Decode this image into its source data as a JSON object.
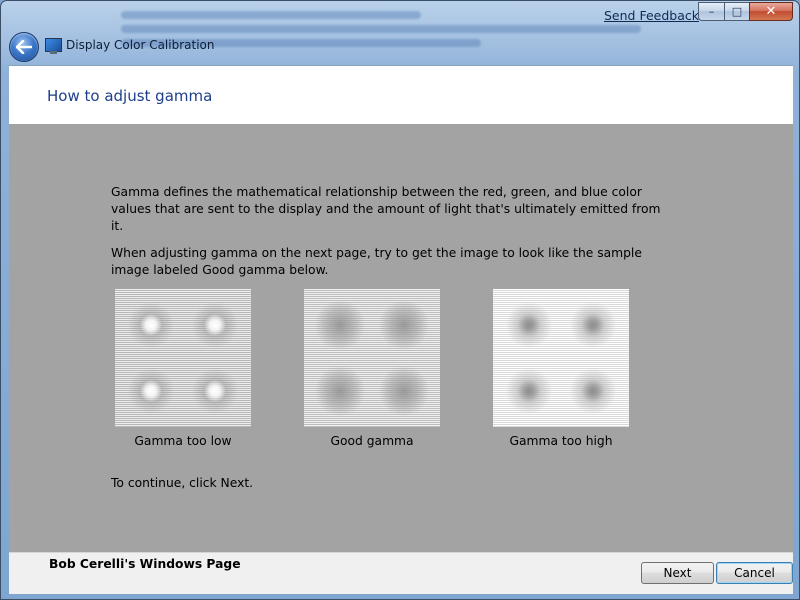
{
  "window": {
    "title": "Display Color Calibration",
    "feedback_link": "Send Feedback",
    "caption_buttons": {
      "minimize": "–",
      "maximize": "□",
      "close": "✕"
    }
  },
  "header": {
    "heading": "How to adjust gamma"
  },
  "content": {
    "paragraph1": "Gamma defines the mathematical relationship between the red, green, and blue color values that are sent to the display and the amount of light that's ultimately emitted from it.",
    "paragraph2": "When adjusting gamma on the next page, try to get the image to look like the sample image labeled Good gamma below.",
    "samples": [
      {
        "caption": "Gamma too low"
      },
      {
        "caption": "Good gamma"
      },
      {
        "caption": "Gamma too high"
      }
    ],
    "continue_text": "To continue, click Next."
  },
  "footer": {
    "brand": "Bob Cerelli's Windows Page",
    "next_button": "Next",
    "cancel_button": "Cancel"
  },
  "icons": {
    "back": "back-arrow-icon",
    "app": "monitor-icon"
  }
}
